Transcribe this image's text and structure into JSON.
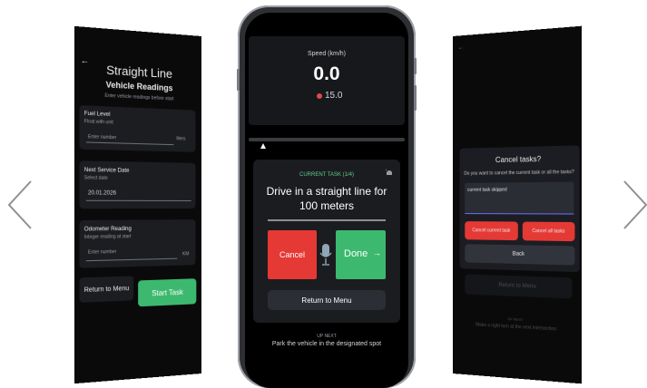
{
  "left_screen": {
    "back": "←",
    "title": "Straight Line",
    "subtitle": "Vehicle Readings",
    "description": "Enter vehicle readings before start",
    "fuel": {
      "label": "Fuel Level",
      "hint": "Float with unit",
      "placeholder": "Enter number",
      "unit": "liters"
    },
    "service": {
      "label": "Next Service Date",
      "hint": "Select date",
      "value": "20.01.2026"
    },
    "odometer": {
      "label": "Odometer Reading",
      "hint": "Integer reading at start",
      "placeholder": "Enter number",
      "unit": "KM"
    },
    "return_label": "Return to Menu",
    "start_label": "Start Task"
  },
  "center_screen": {
    "back": "←",
    "speed_label": "Speed (km/h)",
    "speed_value": "0.0",
    "target_speed": "15.0",
    "task_header": "CURRENT TASK (1/4)",
    "task_text": "Drive in a straight line for 100 meters",
    "cancel_label": "Cancel",
    "done_label": "Done",
    "done_arrow": "→",
    "return_label": "Return to Menu",
    "up_next_label": "UP NEXT",
    "up_next_text": "Park the vehicle in the designated spot",
    "icons": [
      "microphone-icon",
      "siren-icon",
      "back-arrow-icon"
    ]
  },
  "right_screen": {
    "back": "←",
    "dialog_title": "Cancel tasks?",
    "dialog_question": "Do you want to cancel the current task or all the tasks?",
    "input_value": "current task skipped",
    "cancel_current_label": "Cancel current task",
    "cancel_all_label": "Cancel all tasks",
    "back_label": "Back",
    "bg_return_label": "Return to Menu",
    "bg_up_next_label": "UP NEXT",
    "bg_up_next_text": "Make a right turn at the next intersection"
  },
  "colors": {
    "accent_green": "#3cb96e",
    "cancel_red": "#e53935",
    "panel_bg": "#0a0a0b",
    "card_bg": "#1c1d21",
    "task_header_green": "#5ed08d"
  }
}
